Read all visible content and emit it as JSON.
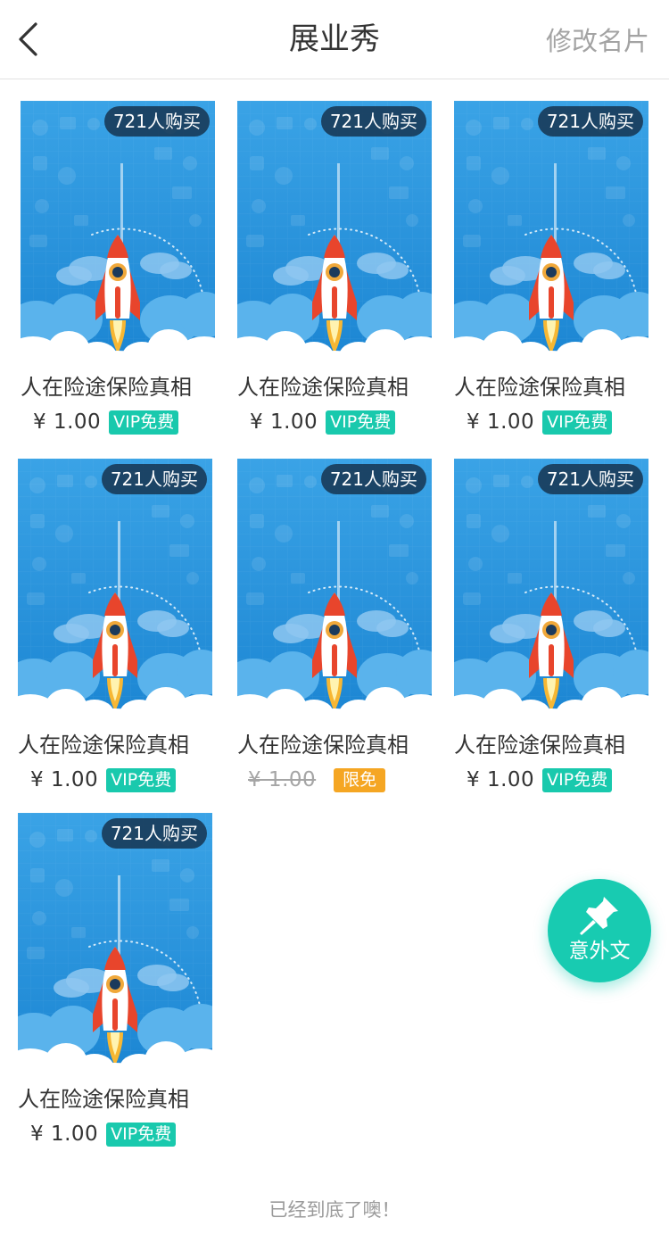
{
  "header": {
    "title": "展业秀",
    "action_label": "修改名片"
  },
  "products": [
    {
      "title": "人在险途保险真相",
      "price": "¥ 1.00",
      "tag": "VIP免费",
      "buyers": "721人购买",
      "discounted": false
    },
    {
      "title": "人在险途保险真相",
      "price": "¥ 1.00",
      "tag": "VIP免费",
      "buyers": "721人购买",
      "discounted": false
    },
    {
      "title": "人在险途保险真相",
      "price": "¥ 1.00",
      "tag": "VIP免费",
      "buyers": "721人购买",
      "discounted": false
    },
    {
      "title": "人在险途保险真相",
      "price": "¥ 1.00",
      "tag": "VIP免费",
      "buyers": "721人购买",
      "discounted": false
    },
    {
      "title": "人在险途保险真相",
      "price": "¥ 1.00",
      "tag": "限免",
      "buyers": "721人购买",
      "discounted": true
    },
    {
      "title": "人在险途保险真相",
      "price": "¥ 1.00",
      "tag": "VIP免费",
      "buyers": "721人购买",
      "discounted": false
    },
    {
      "title": "人在险途保险真相",
      "price": "¥ 1.00",
      "tag": "VIP免费",
      "buyers": "721人购买",
      "discounted": false
    }
  ],
  "fab": {
    "label": "意外文",
    "icon": "pushpin-icon"
  },
  "footer": {
    "end_note": "已经到底了噢！"
  },
  "colors": {
    "accent": "#19c9ad",
    "limited_free": "#f5a623",
    "cover_blue": "#2a93dc"
  }
}
